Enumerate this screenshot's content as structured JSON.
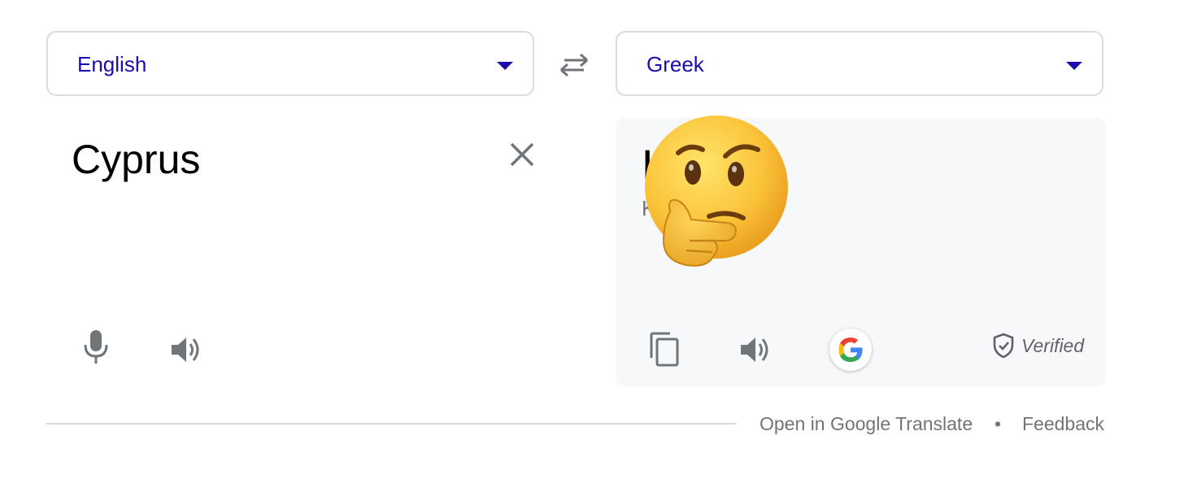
{
  "source_language": {
    "label": "English"
  },
  "target_language": {
    "label": "Greek"
  },
  "source": {
    "text": "Cyprus"
  },
  "result": {
    "text": "K    s",
    "transliteration": "K"
  },
  "badges": {
    "verified_label": "Verified"
  },
  "footer": {
    "open_link": "Open in Google Translate",
    "separator": "•",
    "feedback_link": "Feedback"
  },
  "colors": {
    "accent": "#1a0dab",
    "icon_gray": "#70757a",
    "result_bg": "#f7f8fa",
    "border": "#dadce0"
  },
  "icons": {
    "swap": "swap-arrows-icon",
    "clear": "close-icon",
    "mic": "microphone-icon",
    "speak": "speaker-icon",
    "copy": "copy-icon",
    "google": "google-g-icon",
    "verified": "shield-check-icon",
    "overlay": "thinking-face-emoji"
  }
}
